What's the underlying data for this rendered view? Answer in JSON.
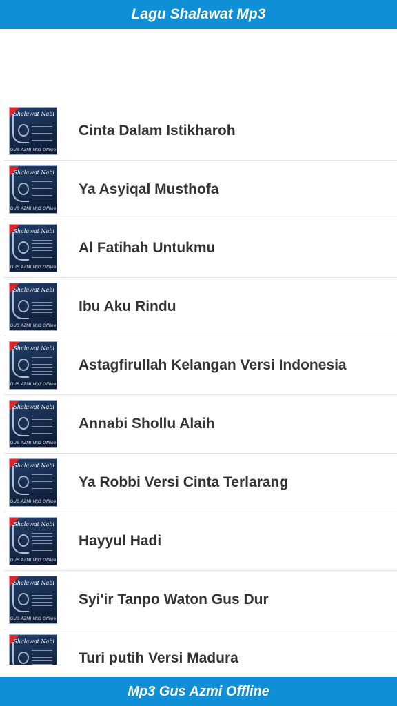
{
  "header": {
    "title": "Lagu Shalawat Mp3"
  },
  "thumbnail": {
    "title_text": "Shalawat Nabi",
    "footer_text": "GUS AZMI Mp3 Offline"
  },
  "songs": [
    {
      "title": "Cinta Dalam Istikharoh"
    },
    {
      "title": "Ya Asyiqal Musthofa"
    },
    {
      "title": "Al Fatihah Untukmu"
    },
    {
      "title": "Ibu Aku Rindu"
    },
    {
      "title": "Astagfirullah Kelangan Versi Indonesia"
    },
    {
      "title": "Annabi Shollu Alaih"
    },
    {
      "title": "Ya Robbi Versi Cinta Terlarang"
    },
    {
      "title": "Hayyul Hadi"
    },
    {
      "title": "Syi'ir Tanpo Waton Gus Dur"
    },
    {
      "title": "Turi putih Versi Madura"
    }
  ],
  "footer": {
    "title": "Mp3 Gus Azmi Offline"
  },
  "colors": {
    "accent": "#0f8fd5",
    "text": "#333333",
    "divider": "#e3e3e3"
  }
}
